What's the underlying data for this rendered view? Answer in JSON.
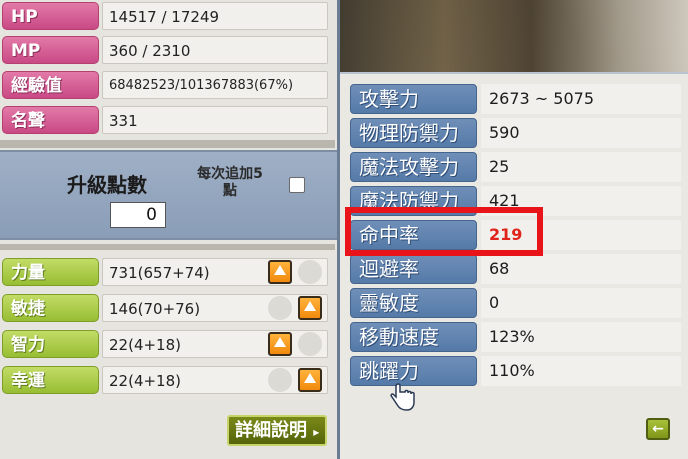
{
  "left": {
    "stats": [
      {
        "label": "HP",
        "value": "14517 / 17249"
      },
      {
        "label": "MP",
        "value": "360 / 2310"
      },
      {
        "label": "經驗值",
        "value": "68482523/101367883(67%)"
      },
      {
        "label": "名聲",
        "value": "331"
      }
    ],
    "upgrade": {
      "label": "升級點數",
      "points": "0",
      "per_add_line1": "每次追加5",
      "per_add_line2": "點"
    },
    "attributes": [
      {
        "label": "力量",
        "value": "731(657+74)"
      },
      {
        "label": "敏捷",
        "value": "146(70+76)"
      },
      {
        "label": "智力",
        "value": "22(4+18)"
      },
      {
        "label": "幸運",
        "value": "22(4+18)"
      }
    ],
    "detail_button": "詳細說明"
  },
  "right": {
    "stats": [
      {
        "label": "攻擊力",
        "value": "2673 ~ 5075"
      },
      {
        "label": "物理防禦力",
        "value": "590"
      },
      {
        "label": "魔法攻擊力",
        "value": "25"
      },
      {
        "label": "魔法防禦力",
        "value": "421"
      },
      {
        "label": "命中率",
        "value": "219"
      },
      {
        "label": "迴避率",
        "value": "68"
      },
      {
        "label": "靈敏度",
        "value": "0"
      },
      {
        "label": "移動速度",
        "value": "123%"
      },
      {
        "label": "跳躍力",
        "value": "110%"
      }
    ],
    "highlighted_stat": "命中率"
  },
  "colors": {
    "highlight_border": "#e8141a",
    "highlight_value": "#e0241b",
    "stat_label_blue": "#557aa8",
    "hp_mp_pink": "#c94985",
    "attribute_green": "#98bd33"
  }
}
